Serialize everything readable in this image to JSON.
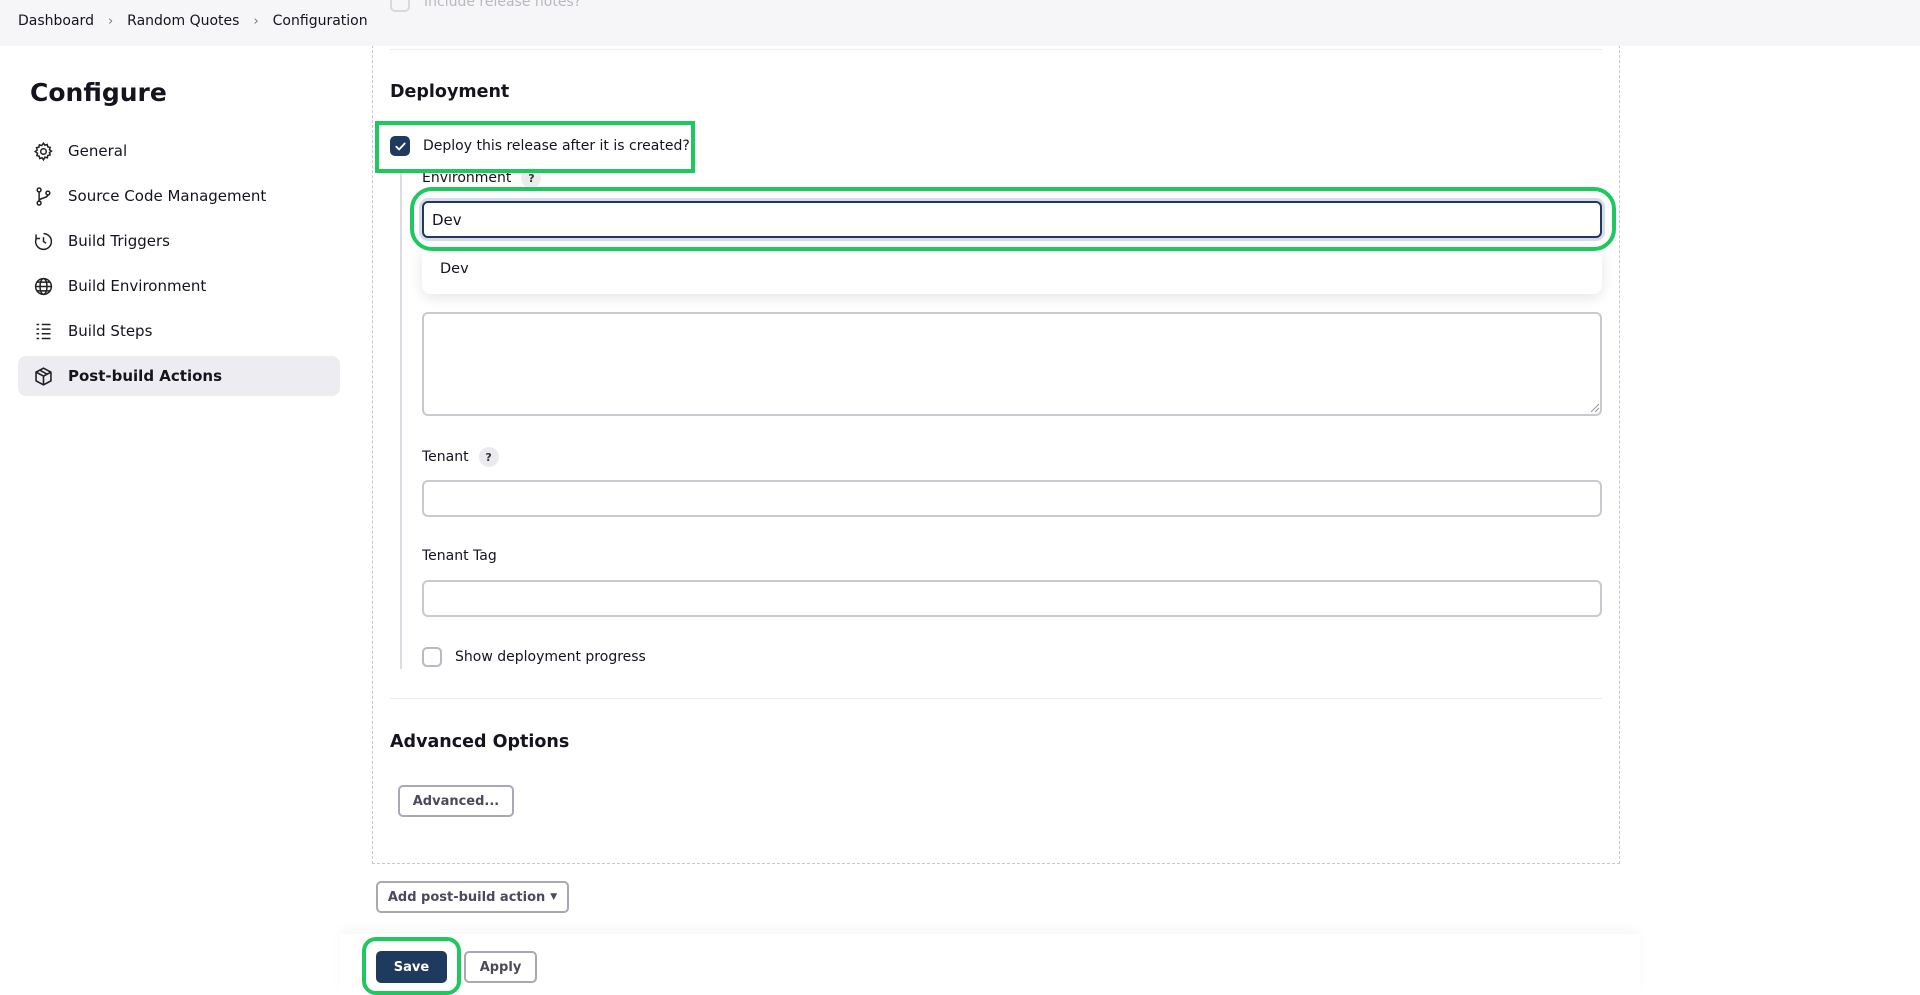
{
  "breadcrumb": [
    "Dashboard",
    "Random Quotes",
    "Configuration"
  ],
  "ghost_option": "Include release notes?",
  "sidebar": {
    "title": "Configure",
    "items": [
      {
        "label": "General",
        "icon": "gear-icon",
        "active": false
      },
      {
        "label": "Source Code Management",
        "icon": "git-branch-icon",
        "active": false
      },
      {
        "label": "Build Triggers",
        "icon": "clock-icon",
        "active": false
      },
      {
        "label": "Build Environment",
        "icon": "globe-icon",
        "active": false
      },
      {
        "label": "Build Steps",
        "icon": "list-icon",
        "active": false
      },
      {
        "label": "Post-build Actions",
        "icon": "package-icon",
        "active": true
      }
    ]
  },
  "deployment": {
    "title": "Deployment",
    "deploy_checkbox_label": "Deploy this release after it is created?",
    "deploy_checked": true,
    "environment_label": "Environment",
    "environment_value": "Dev",
    "environment_suggestion": "Dev",
    "variables_value": "",
    "tenant_label": "Tenant",
    "tenant_value": "",
    "tenant_tag_label": "Tenant Tag",
    "tenant_tag_value": "",
    "show_progress_label": "Show deployment progress",
    "show_progress_checked": false,
    "help_glyph": "?"
  },
  "advanced": {
    "title": "Advanced Options",
    "button_label": "Advanced..."
  },
  "footer": {
    "add_action_label": "Add post-build action",
    "save_label": "Save",
    "apply_label": "Apply"
  },
  "colors": {
    "primary": "#1f3a5f",
    "highlight": "#1ec85f",
    "active_nav_bg": "#ededf1"
  }
}
